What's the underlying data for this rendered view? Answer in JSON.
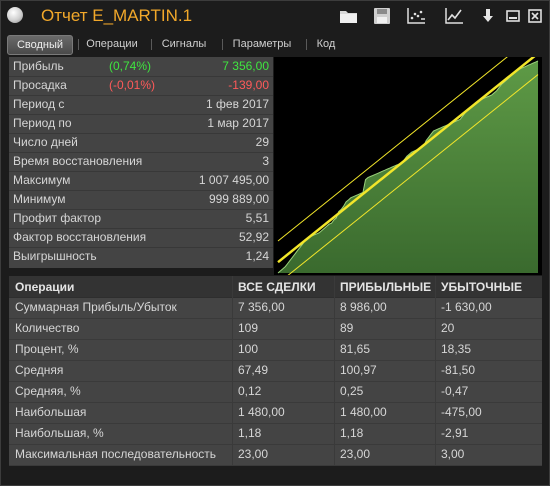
{
  "window": {
    "title": "Отчет E_MARTIN.1",
    "toolbar_icons": [
      "folder-icon",
      "save-icon",
      "chart-points-icon",
      "line-chart-icon",
      "download-icon",
      "minimize-icon",
      "close-icon"
    ]
  },
  "tabs": [
    "Сводный",
    "Операции",
    "Сигналы",
    "Параметры",
    "Код"
  ],
  "active_tab": "Сводный",
  "stats": [
    {
      "label": "Прибыль",
      "pct": "(0,74%)",
      "value": "7 356,00",
      "color": "#3fe63f"
    },
    {
      "label": "Просадка",
      "pct": "(-0,01%)",
      "value": "-139,00",
      "color": "#ff5a5a"
    },
    {
      "label": "Период с",
      "value": "1 фев 2017"
    },
    {
      "label": "Период по",
      "value": "1 мар 2017"
    },
    {
      "label": "Число дней",
      "value": "29"
    },
    {
      "label": "Время восстановления",
      "value": "3"
    },
    {
      "label": "Максимум",
      "value": "1 007 495,00"
    },
    {
      "label": "Минимум",
      "value": "999 889,00"
    },
    {
      "label": "Профит фактор",
      "value": "5,51"
    },
    {
      "label": "Фактор восстановления",
      "value": "52,92"
    },
    {
      "label": "Выигрышность",
      "value": "1,24"
    }
  ],
  "table": {
    "headers": [
      "Операции",
      "ВСЕ СДЕЛКИ",
      "ПРИБЫЛЬНЫЕ",
      "УБЫТОЧНЫЕ"
    ],
    "rows": [
      [
        "Суммарная Прибыль/Убыток",
        "7 356,00",
        "8 986,00",
        "-1 630,00"
      ],
      [
        "Количество",
        "109",
        "89",
        "20"
      ],
      [
        "Процент, %",
        "100",
        "81,65",
        "18,35"
      ],
      [
        "Средняя",
        "67,49",
        "100,97",
        "-81,50"
      ],
      [
        "Средняя, %",
        "0,12",
        "0,25",
        "-0,47"
      ],
      [
        "Наибольшая",
        "1 480,00",
        "1 480,00",
        "-475,00"
      ],
      [
        "Наибольшая, %",
        "1,18",
        "1,18",
        "-2,91"
      ],
      [
        "Максимальная последовательность",
        "23,00",
        "23,00",
        "3,00"
      ]
    ]
  },
  "chart_data": {
    "type": "area",
    "series": [
      {
        "values": [
          0,
          2,
          4,
          6,
          9,
          12,
          15,
          18,
          21,
          24,
          27,
          30,
          32,
          34,
          35,
          36,
          37,
          38,
          40,
          42,
          44,
          46,
          47,
          50,
          52,
          58,
          60,
          63,
          67,
          69,
          71,
          72,
          73,
          74,
          75,
          76,
          88,
          90,
          91,
          92,
          93,
          94,
          95,
          96,
          97,
          98,
          99,
          100,
          101,
          102,
          103,
          104,
          107,
          110,
          112,
          114,
          115,
          116,
          117,
          118,
          120,
          125,
          128,
          131,
          134,
          135,
          136,
          137,
          138,
          139,
          140,
          141,
          142,
          143,
          144,
          145,
          148,
          151,
          154,
          156,
          158,
          160,
          162,
          163,
          164,
          165,
          166,
          167,
          168,
          170,
          172,
          175,
          178,
          180,
          182,
          184,
          186,
          188,
          190,
          192,
          193,
          194,
          195,
          196,
          197,
          198,
          199,
          200
        ]
      }
    ],
    "accent": "#f2e62a",
    "fill": "#3a6a2e"
  }
}
